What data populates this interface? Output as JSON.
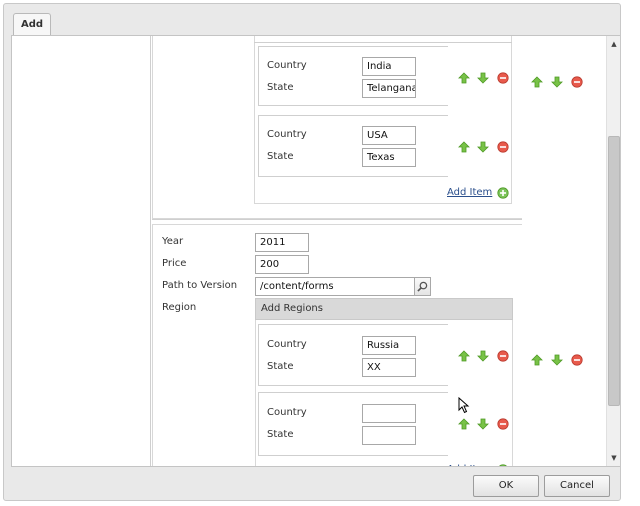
{
  "tabs": [
    {
      "label": "Add"
    }
  ],
  "regions_top": [
    {
      "country_label": "Country",
      "country": "India",
      "state_label": "State",
      "state": "Telangana"
    },
    {
      "country_label": "Country",
      "country": "USA",
      "state_label": "State",
      "state": "Texas"
    }
  ],
  "add_item_label": "Add Item",
  "form": {
    "year_label": "Year",
    "year": "2011",
    "price_label": "Price",
    "price": "200",
    "path_label": "Path to Version",
    "path": "/content/forms",
    "region_label": "Region"
  },
  "add_regions_label": "Add Regions",
  "regions_bottom": [
    {
      "country_label": "Country",
      "country": "Russia",
      "state_label": "State",
      "state": "XX"
    },
    {
      "country_label": "Country",
      "country": "",
      "state_label": "State",
      "state": ""
    }
  ],
  "footer": {
    "ok_label": "OK",
    "cancel_label": "Cancel"
  },
  "icons": {
    "move_up": "arrow-up-icon",
    "move_down": "arrow-down-icon",
    "remove": "remove-icon",
    "add": "add-icon",
    "search": "search-icon"
  },
  "colors": {
    "arrow_green": "#6fbf3c",
    "remove_red": "#e04b3f",
    "link_blue": "#2b4f8c"
  }
}
